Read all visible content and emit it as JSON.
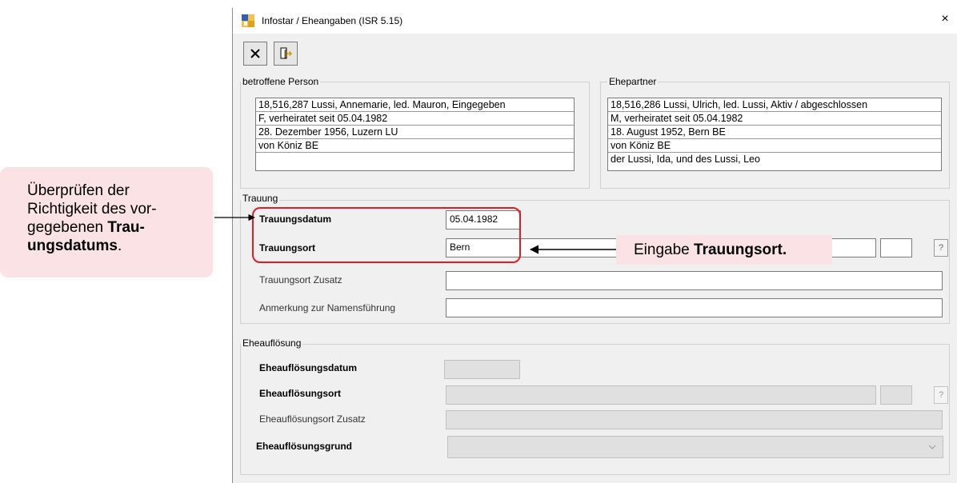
{
  "window": {
    "title": "Infostar / Eheangaben (ISR 5.15)",
    "close_glyph": "×",
    "app_icon": "infostar-app-icon"
  },
  "toolbar": {
    "cancel_glyph": "✕",
    "cancel_icon": "close-x-icon",
    "exit_icon": "exit-door-icon"
  },
  "person": {
    "group_label": "betroffene Person",
    "rows": [
      "18,516,287  Lussi, Annemarie, led. Mauron, Eingegeben",
      "F, verheiratet seit 05.04.1982",
      "28. Dezember 1956, Luzern LU",
      "von Köniz BE",
      ""
    ]
  },
  "partner": {
    "group_label": "Ehepartner",
    "rows": [
      "18,516,286  Lussi, Ulrich, led. Lussi, Aktiv / abgeschlossen",
      "M, verheiratet seit 05.04.1982",
      "18. August 1952, Bern BE",
      "von Köniz BE",
      "der Lussi, Ida, und des Lussi, Leo"
    ]
  },
  "trauung": {
    "group_label": "Trauung",
    "datum_label": "Trauungsdatum",
    "datum_value": "05.04.1982",
    "ort_label": "Trauungsort",
    "ort_value": "Bern",
    "ort_help": "?",
    "zusatz_label": "Trauungsort Zusatz",
    "zusatz_value": "",
    "anmerkung_label": "Anmerkung zur Namensführung",
    "anmerkung_value": ""
  },
  "eheaufloesung": {
    "group_label": "Eheauflösung",
    "datum_label": "Eheauflösungsdatum",
    "ort_label": "Eheauflösungsort",
    "ort_help": "?",
    "zusatz_label": "Eheauflösungsort Zusatz",
    "grund_label": "Eheauflösungsgrund",
    "grund_value": ""
  },
  "annotations": {
    "left_lines": [
      "Überprüfen der",
      "Richtigkeit des vor-",
      "gegebenen "
    ],
    "left_bold_1": "Trau-",
    "left_bold_2": "ungsdatums",
    "left_tail": ".",
    "right_prefix": "Eingabe ",
    "right_bold": "Trauungsort.",
    "highlight_color": "#e31b23",
    "callout_bg": "#fbe3e5"
  }
}
